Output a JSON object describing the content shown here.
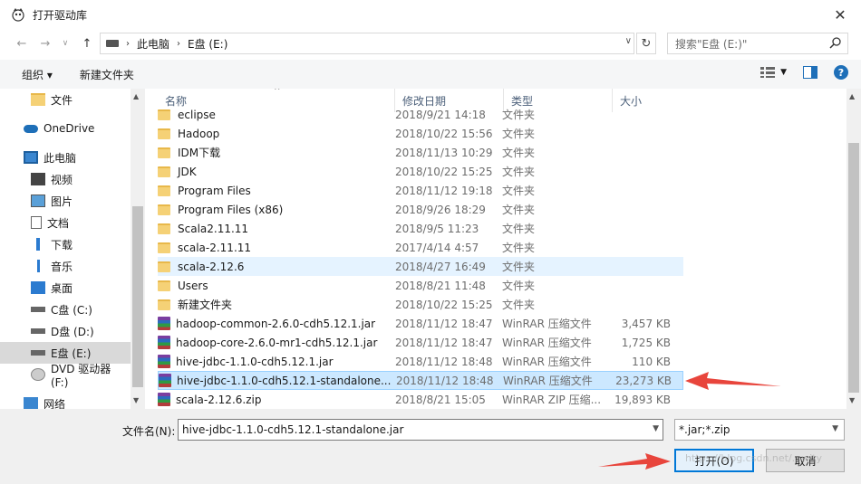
{
  "window": {
    "title": "打开驱动库"
  },
  "address": {
    "crumbs": [
      "此电脑",
      "E盘 (E:)"
    ]
  },
  "search": {
    "placeholder": "搜索\"E盘 (E:)\""
  },
  "toolbar": {
    "organize": "组织 ▾",
    "new_folder": "新建文件夹"
  },
  "nav": [
    {
      "label": "文件",
      "icon": "folder-icon"
    },
    {
      "label": "OneDrive",
      "icon": "cloud-icon"
    },
    {
      "label": "此电脑",
      "icon": "computer-icon"
    },
    {
      "label": "视频",
      "icon": "video-icon"
    },
    {
      "label": "图片",
      "icon": "picture-icon"
    },
    {
      "label": "文档",
      "icon": "document-icon"
    },
    {
      "label": "下载",
      "icon": "download-icon"
    },
    {
      "label": "音乐",
      "icon": "music-icon"
    },
    {
      "label": "桌面",
      "icon": "desktop-icon"
    },
    {
      "label": "C盘 (C:)",
      "icon": "drive-icon"
    },
    {
      "label": "D盘 (D:)",
      "icon": "drive-icon"
    },
    {
      "label": "E盘 (E:)",
      "icon": "drive-icon"
    },
    {
      "label": "DVD 驱动器 (F:)",
      "icon": "dvd-icon"
    },
    {
      "label": "网络",
      "icon": "network-icon"
    }
  ],
  "columns": {
    "name": "名称",
    "date": "修改日期",
    "type": "类型",
    "size": "大小"
  },
  "files": [
    {
      "name": "eclipse",
      "date": "2018/9/21 14:18",
      "type": "文件夹",
      "size": "",
      "kind": "folder"
    },
    {
      "name": "Hadoop",
      "date": "2018/10/22 15:56",
      "type": "文件夹",
      "size": "",
      "kind": "folder"
    },
    {
      "name": "IDM下载",
      "date": "2018/11/13 10:29",
      "type": "文件夹",
      "size": "",
      "kind": "folder"
    },
    {
      "name": "JDK",
      "date": "2018/10/22 15:25",
      "type": "文件夹",
      "size": "",
      "kind": "folder"
    },
    {
      "name": "Program Files",
      "date": "2018/11/12 19:18",
      "type": "文件夹",
      "size": "",
      "kind": "folder"
    },
    {
      "name": "Program Files (x86)",
      "date": "2018/9/26 18:29",
      "type": "文件夹",
      "size": "",
      "kind": "folder"
    },
    {
      "name": "Scala2.11.11",
      "date": "2018/9/5 11:23",
      "type": "文件夹",
      "size": "",
      "kind": "folder"
    },
    {
      "name": "scala-2.11.11",
      "date": "2017/4/14 4:57",
      "type": "文件夹",
      "size": "",
      "kind": "folder"
    },
    {
      "name": "scala-2.12.6",
      "date": "2018/4/27 16:49",
      "type": "文件夹",
      "size": "",
      "kind": "folder"
    },
    {
      "name": "Users",
      "date": "2018/8/21 11:48",
      "type": "文件夹",
      "size": "",
      "kind": "folder"
    },
    {
      "name": "新建文件夹",
      "date": "2018/10/22 15:25",
      "type": "文件夹",
      "size": "",
      "kind": "folder"
    },
    {
      "name": "hadoop-common-2.6.0-cdh5.12.1.jar",
      "date": "2018/11/12 18:47",
      "type": "WinRAR 压缩文件",
      "size": "3,457 KB",
      "kind": "rar"
    },
    {
      "name": "hadoop-core-2.6.0-mr1-cdh5.12.1.jar",
      "date": "2018/11/12 18:47",
      "type": "WinRAR 压缩文件",
      "size": "1,725 KB",
      "kind": "rar"
    },
    {
      "name": "hive-jdbc-1.1.0-cdh5.12.1.jar",
      "date": "2018/11/12 18:48",
      "type": "WinRAR 压缩文件",
      "size": "110 KB",
      "kind": "rar"
    },
    {
      "name": "hive-jdbc-1.1.0-cdh5.12.1-standalone....",
      "date": "2018/11/12 18:48",
      "type": "WinRAR 压缩文件",
      "size": "23,273 KB",
      "kind": "rar"
    },
    {
      "name": "scala-2.12.6.zip",
      "date": "2018/8/21 15:05",
      "type": "WinRAR ZIP 压缩...",
      "size": "19,893 KB",
      "kind": "rar"
    }
  ],
  "filename": {
    "label": "文件名(N):",
    "value": "hive-jdbc-1.1.0-cdh5.12.1-standalone.jar"
  },
  "filter": {
    "value": "*.jar;*.zip"
  },
  "buttons": {
    "open": "打开(O)",
    "cancel": "取消"
  },
  "watermark": "https://blog.csdn.net/...wity",
  "colors": {
    "selected_bg": "#cce8ff",
    "hover_bg": "#e5f3ff",
    "folder": "#f5d176",
    "accent": "#0078d7",
    "arrow": "#e8453c"
  }
}
